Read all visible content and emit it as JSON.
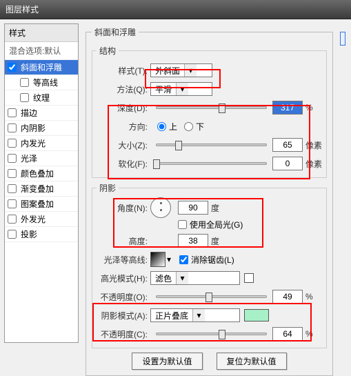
{
  "title": "图层样式",
  "sidebar": {
    "header": "样式",
    "blend": "混合选项:默认",
    "items": [
      {
        "label": "斜面和浮雕",
        "checked": true,
        "active": true,
        "sub": false
      },
      {
        "label": "等高线",
        "checked": false,
        "active": false,
        "sub": true
      },
      {
        "label": "纹理",
        "checked": false,
        "active": false,
        "sub": true
      },
      {
        "label": "描边",
        "checked": false,
        "active": false,
        "sub": false
      },
      {
        "label": "内阴影",
        "checked": false,
        "active": false,
        "sub": false
      },
      {
        "label": "内发光",
        "checked": false,
        "active": false,
        "sub": false
      },
      {
        "label": "光泽",
        "checked": false,
        "active": false,
        "sub": false
      },
      {
        "label": "颜色叠加",
        "checked": false,
        "active": false,
        "sub": false
      },
      {
        "label": "渐变叠加",
        "checked": false,
        "active": false,
        "sub": false
      },
      {
        "label": "图案叠加",
        "checked": false,
        "active": false,
        "sub": false
      },
      {
        "label": "外发光",
        "checked": false,
        "active": false,
        "sub": false
      },
      {
        "label": "投影",
        "checked": false,
        "active": false,
        "sub": false
      }
    ]
  },
  "bevel": {
    "group_title": "斜面和浮雕",
    "structure_title": "结构",
    "style_label": "样式(T):",
    "style_value": "外斜面",
    "method_label": "方法(Q):",
    "method_value": "平滑",
    "depth_label": "深度(D):",
    "depth_value": "317",
    "depth_unit": "%",
    "depth_pct": 60,
    "direction_label": "方向:",
    "up": "上",
    "down": "下",
    "dir_up_selected": true,
    "size_label": "大小(Z):",
    "size_value": "65",
    "size_unit": "像素",
    "size_pct": 20,
    "soften_label": "软化(F):",
    "soften_value": "0",
    "soften_unit": "像素",
    "soften_pct": 0
  },
  "shadow": {
    "title": "阴影",
    "angle_label": "角度(N):",
    "angle_value": "90",
    "angle_unit": "度",
    "global_label": "使用全局光(G)",
    "global_checked": false,
    "altitude_label": "高度:",
    "altitude_value": "38",
    "altitude_unit": "度",
    "gloss_label": "光泽等高线:",
    "antialias_label": "消除锯齿(L)",
    "antialias_checked": true,
    "hi_mode_label": "高光模式(H):",
    "hi_mode_value": "滤色",
    "hi_opacity_label": "不透明度(O):",
    "hi_opacity_value": "49",
    "hi_opacity_unit": "%",
    "hi_opacity_pct": 48,
    "sh_mode_label": "阴影模式(A):",
    "sh_mode_value": "正片叠底",
    "sh_opacity_label": "不透明度(C):",
    "sh_opacity_value": "64",
    "sh_opacity_unit": "%",
    "sh_opacity_pct": 60,
    "sh_color": "#a8f0c8"
  },
  "buttons": {
    "default": "设置为默认值",
    "reset": "复位为默认值"
  }
}
